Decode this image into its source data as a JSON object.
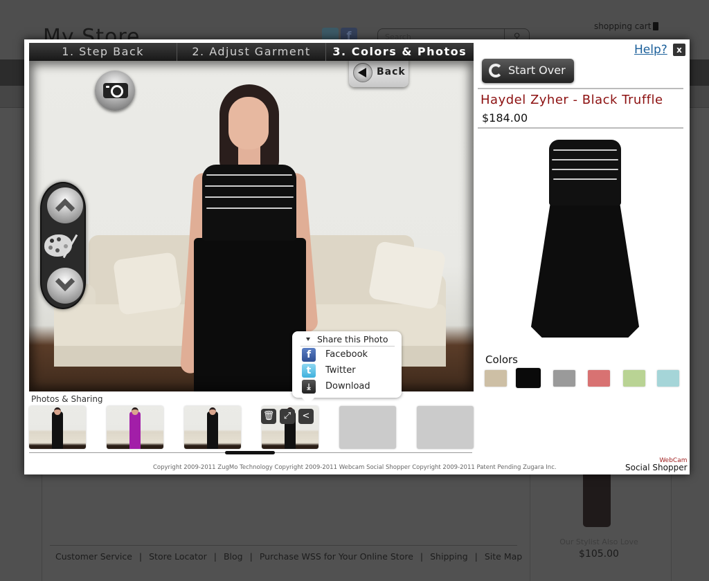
{
  "background_page": {
    "store_title": "My Store",
    "search_placeholder": "Search",
    "shopping_cart_label": "shopping cart",
    "footer_links": [
      "Customer Service",
      "Store Locator",
      "Blog",
      "Purchase WSS for Your Online Store",
      "Shipping",
      "Site Map"
    ],
    "footer_separator": "|",
    "stylist_label": "Our Stylist Also Love",
    "stylist_price": "$105.00"
  },
  "modal": {
    "tabs": [
      {
        "label": "1. Step Back",
        "active": false
      },
      {
        "label": "2. Adjust Garment",
        "active": false
      },
      {
        "label": "3. Colors & Photos",
        "active": true
      }
    ],
    "back_label": "Back",
    "help_label": "Help?",
    "close_label": "x",
    "start_over_label": "Start Over",
    "product": {
      "name": "Haydel Zyher - Black Truffle",
      "price": "$184.00"
    },
    "colors_label": "Colors",
    "colors": [
      {
        "name": "beige",
        "hex": "#cdbfa5",
        "selected": false
      },
      {
        "name": "black",
        "hex": "#0a0a0a",
        "selected": true
      },
      {
        "name": "gray",
        "hex": "#9a9a9a",
        "selected": false
      },
      {
        "name": "coral",
        "hex": "#d87272",
        "selected": false
      },
      {
        "name": "green",
        "hex": "#b9d394",
        "selected": false
      },
      {
        "name": "aqua",
        "hex": "#a5d5d8",
        "selected": false
      }
    ],
    "share_popup": {
      "title": "Share this Photo",
      "items": [
        {
          "label": "Facebook",
          "icon": "facebook-icon",
          "glyph": "f"
        },
        {
          "label": "Twitter",
          "icon": "twitter-icon",
          "glyph": "t"
        },
        {
          "label": "Download",
          "icon": "download-icon",
          "glyph": "⤓"
        }
      ]
    },
    "photos_label": "Photos & Sharing",
    "thumbnails": [
      {
        "type": "photo",
        "dress_color": "#111111"
      },
      {
        "type": "photo",
        "dress_color": "#a21ea8"
      },
      {
        "type": "photo",
        "dress_color": "#111111"
      },
      {
        "type": "photo",
        "dress_color": "#111111",
        "has_tools": true
      },
      {
        "type": "empty"
      },
      {
        "type": "empty"
      }
    ],
    "thumb_tools": [
      {
        "name": "delete-icon",
        "glyph": "🗑"
      },
      {
        "name": "expand-icon",
        "glyph": "⤢"
      },
      {
        "name": "share-icon",
        "glyph": "<"
      }
    ],
    "copyright": "Copyright 2009-2011 ZugMo Technology Copyright 2009-2011 Webcam Social Shopper Copyright 2009-2011 Patent Pending Zugara Inc.",
    "brand_top": "WebCam",
    "brand_bottom": "Social Shopper"
  }
}
